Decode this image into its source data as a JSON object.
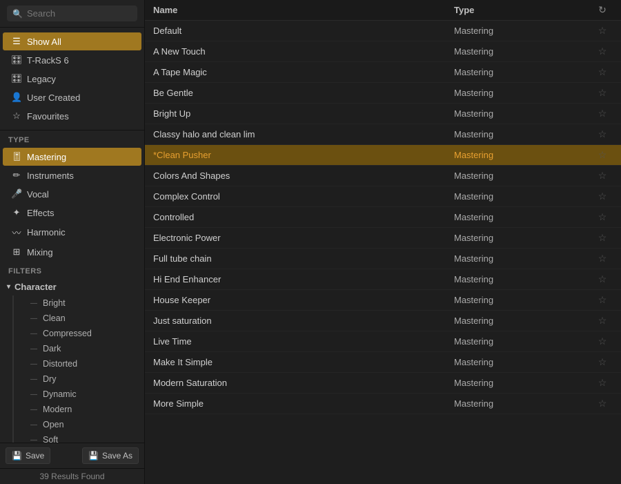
{
  "sidebar": {
    "search": {
      "placeholder": "Search",
      "value": ""
    },
    "nav_items": [
      {
        "id": "show-all",
        "label": "Show All",
        "icon": "☰",
        "active": true
      },
      {
        "id": "t-racks",
        "label": "T-RackS 6",
        "icon": "🎛",
        "active": false
      },
      {
        "id": "legacy",
        "label": "Legacy",
        "icon": "🎛",
        "active": false
      },
      {
        "id": "user-created",
        "label": "User Created",
        "icon": "👤",
        "active": false
      },
      {
        "id": "favourites",
        "label": "Favourites",
        "icon": "☆",
        "active": false
      }
    ],
    "type_section_label": "Type",
    "type_items": [
      {
        "id": "mastering",
        "label": "Mastering",
        "icon": "🎚",
        "active": true
      },
      {
        "id": "instruments",
        "label": "Instruments",
        "icon": "✏",
        "active": false
      },
      {
        "id": "vocal",
        "label": "Vocal",
        "icon": "🎤",
        "active": false
      },
      {
        "id": "effects",
        "label": "Effects",
        "icon": "✦",
        "active": false
      },
      {
        "id": "harmonic",
        "label": "Harmonic",
        "icon": "〰",
        "active": false
      },
      {
        "id": "mixing",
        "label": "Mixing",
        "icon": "⊞",
        "active": false
      }
    ],
    "filters_section_label": "Filters",
    "filter_groups": [
      {
        "id": "character",
        "label": "Character",
        "expanded": true,
        "items": [
          "Bright",
          "Clean",
          "Compressed",
          "Dark",
          "Distorted",
          "Dry",
          "Dynamic",
          "Modern",
          "Open",
          "Soft"
        ]
      }
    ],
    "footer": {
      "save_label": "Save",
      "save_as_label": "Save As",
      "save_icon": "💾",
      "save_as_icon": "💾"
    },
    "results_count": "39 Results Found"
  },
  "table": {
    "columns": {
      "name": "Name",
      "type": "Type",
      "action": "↻"
    },
    "rows": [
      {
        "id": 1,
        "name": "Default",
        "type": "Mastering",
        "active": false
      },
      {
        "id": 2,
        "name": "A New Touch",
        "type": "Mastering",
        "active": false
      },
      {
        "id": 3,
        "name": "A Tape Magic",
        "type": "Mastering",
        "active": false
      },
      {
        "id": 4,
        "name": "Be Gentle",
        "type": "Mastering",
        "active": false
      },
      {
        "id": 5,
        "name": "Bright Up",
        "type": "Mastering",
        "active": false
      },
      {
        "id": 6,
        "name": "Classy halo and clean lim",
        "type": "Mastering",
        "active": false
      },
      {
        "id": 7,
        "name": "*Clean Pusher",
        "type": "Mastering",
        "active": true
      },
      {
        "id": 8,
        "name": "Colors And Shapes",
        "type": "Mastering",
        "active": false
      },
      {
        "id": 9,
        "name": "Complex Control",
        "type": "Mastering",
        "active": false
      },
      {
        "id": 10,
        "name": "Controlled",
        "type": "Mastering",
        "active": false
      },
      {
        "id": 11,
        "name": "Electronic Power",
        "type": "Mastering",
        "active": false
      },
      {
        "id": 12,
        "name": "Full tube chain",
        "type": "Mastering",
        "active": false
      },
      {
        "id": 13,
        "name": "Hi End Enhancer",
        "type": "Mastering",
        "active": false
      },
      {
        "id": 14,
        "name": "House Keeper",
        "type": "Mastering",
        "active": false
      },
      {
        "id": 15,
        "name": "Just saturation",
        "type": "Mastering",
        "active": false
      },
      {
        "id": 16,
        "name": "Live Time",
        "type": "Mastering",
        "active": false
      },
      {
        "id": 17,
        "name": "Make It Simple",
        "type": "Mastering",
        "active": false
      },
      {
        "id": 18,
        "name": "Modern Saturation",
        "type": "Mastering",
        "active": false
      },
      {
        "id": 19,
        "name": "More Simple",
        "type": "Mastering",
        "active": false
      }
    ]
  }
}
